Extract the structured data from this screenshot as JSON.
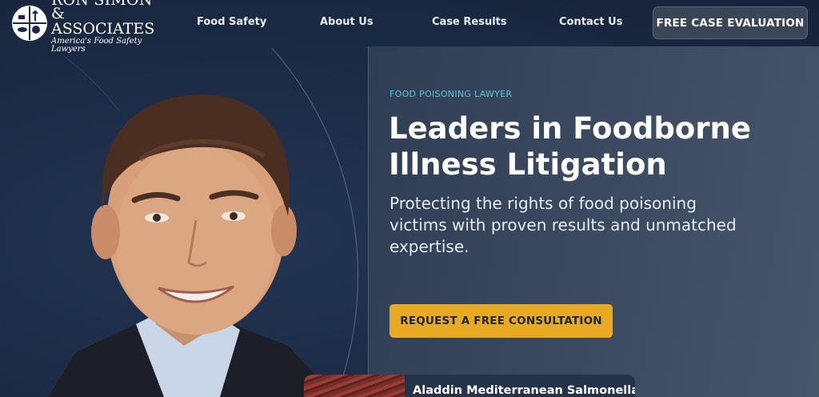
{
  "brand": {
    "name_line1": "RON SIMON",
    "name_line2": "& ASSOCIATES",
    "tagline": "America's Food Safety Lawyers"
  },
  "nav": {
    "items": [
      {
        "label": "Food Safety"
      },
      {
        "label": "About Us"
      },
      {
        "label": "Case Results"
      },
      {
        "label": "Contact Us"
      }
    ],
    "cta_label": "FREE CASE EVALUATION"
  },
  "hero": {
    "eyebrow": "FOOD POISONING LAWYER",
    "headline_line1": "Leaders in Foodborne",
    "headline_line2": "Illness Litigation",
    "subheading": "Protecting the rights of food poisoning victims with proven results and unmatched expertise.",
    "button_label": "REQUEST A FREE CONSULTATION"
  },
  "case_card": {
    "title": "Aladdin Mediterranean Salmonella"
  },
  "colors": {
    "accent": "#e8a923",
    "eyebrow": "#5fc4d8",
    "background": "#1b2a44"
  }
}
